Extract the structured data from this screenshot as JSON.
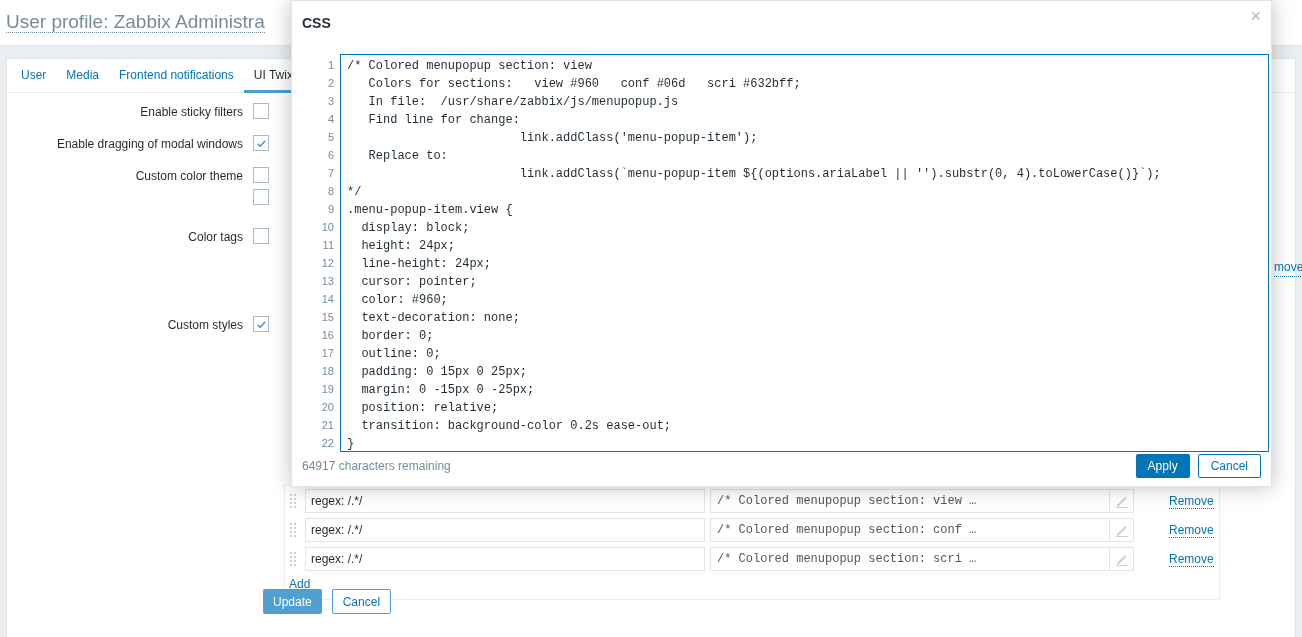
{
  "page_title": "User profile: Zabbix Administra",
  "tabs": [
    {
      "label": "User",
      "selected": false
    },
    {
      "label": "Media",
      "selected": false
    },
    {
      "label": "Frontend notifications",
      "selected": false
    },
    {
      "label": "UI Twix",
      "selected": true
    }
  ],
  "form_rows": [
    {
      "label": "Enable sticky filters",
      "checkboxes": [
        false
      ]
    },
    {
      "label": "Enable dragging of modal windows",
      "checkboxes": [
        true
      ]
    },
    {
      "label": "Custom color theme",
      "checkboxes": [
        false,
        false
      ]
    },
    {
      "label": "Color tags",
      "checkboxes": [
        false
      ]
    },
    {
      "label": "Custom styles",
      "checkboxes": [
        true
      ]
    }
  ],
  "partial_link": "move",
  "styles_rows": [
    {
      "pattern": "regex: /.*/",
      "css": "/* Colored menupopup section: view …",
      "remove": "Remove"
    },
    {
      "pattern": "regex: /.*/",
      "css": "/* Colored menupopup section: conf …",
      "remove": "Remove"
    },
    {
      "pattern": "regex: /.*/",
      "css": "/* Colored menupopup section: scri …",
      "remove": "Remove"
    }
  ],
  "add_link": "Add",
  "buttons": {
    "update": "Update",
    "cancel": "Cancel"
  },
  "modal": {
    "title": "CSS",
    "close": "×",
    "code_lines": [
      {
        "number": "1",
        "text": "/* Colored menupopup section: view"
      },
      {
        "number": "2",
        "text": "   Colors for sections:   view #960   conf #06d   scri #632bff;"
      },
      {
        "number": "3",
        "text": "   In file:  /usr/share/zabbix/js/menupopup.js"
      },
      {
        "number": "4",
        "text": "   Find line for change:"
      },
      {
        "number": "5",
        "text": "                        link.addClass('menu-popup-item');"
      },
      {
        "number": "6",
        "text": "   Replace to:"
      },
      {
        "number": "7",
        "text": "                        link.addClass(`menu-popup-item ${(options.ariaLabel || '').substr(0, 4).toLowerCase()}`);"
      },
      {
        "number": "8",
        "text": "*/"
      },
      {
        "number": "9",
        "text": ".menu-popup-item.view {"
      },
      {
        "number": "10",
        "text": "  display: block;"
      },
      {
        "number": "11",
        "text": "  height: 24px;"
      },
      {
        "number": "12",
        "text": "  line-height: 24px;"
      },
      {
        "number": "13",
        "text": "  cursor: pointer;"
      },
      {
        "number": "14",
        "text": "  color: #960;"
      },
      {
        "number": "15",
        "text": "  text-decoration: none;"
      },
      {
        "number": "16",
        "text": "  border: 0;"
      },
      {
        "number": "17",
        "text": "  outline: 0;"
      },
      {
        "number": "18",
        "text": "  padding: 0 15px 0 25px;"
      },
      {
        "number": "19",
        "text": "  margin: 0 -15px 0 -25px;"
      },
      {
        "number": "20",
        "text": "  position: relative;"
      },
      {
        "number": "21",
        "text": "  transition: background-color 0.2s ease-out;"
      },
      {
        "number": "22",
        "text": "}"
      }
    ],
    "remaining": "64917 characters remaining",
    "apply": "Apply",
    "cancel": "Cancel"
  }
}
